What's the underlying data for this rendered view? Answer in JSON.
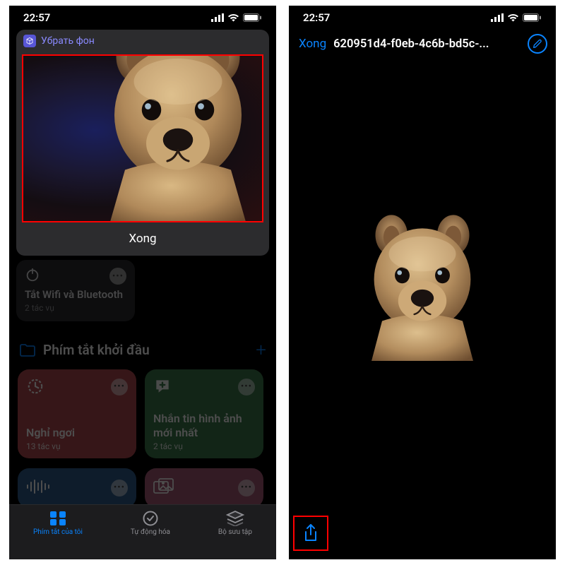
{
  "status": {
    "time": "22:57"
  },
  "left": {
    "banner": {
      "app": "Убрать фон",
      "done": "Xong"
    },
    "wifiCard": {
      "title": "Tắt Wifi và Bluetooth",
      "sub": "2 tác vụ"
    },
    "section": {
      "title": "Phím tắt khởi đầu"
    },
    "cards": [
      {
        "title": "Nghỉ ngơi",
        "sub": "13 tác vụ"
      },
      {
        "title": "Nhắn tin hình ảnh mới nhất",
        "sub": "2 tác vụ"
      }
    ],
    "tabs": {
      "mine": "Phím tắt của tôi",
      "automation": "Tự động hóa",
      "gallery": "Bộ sưu tập"
    }
  },
  "right": {
    "done": "Xong",
    "filename": "620951d4-f0eb-4c6b-bd5c-..."
  }
}
